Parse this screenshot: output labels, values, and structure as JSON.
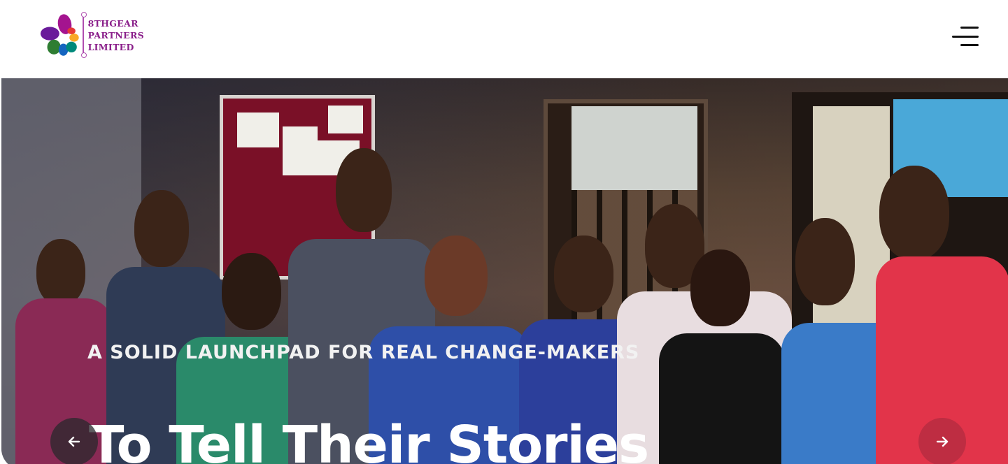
{
  "header": {
    "logo": {
      "line1": "8THGEAR",
      "line2": "PARTNERS",
      "line3": "LIMITED"
    },
    "menu_icon": "hamburger-menu-icon"
  },
  "hero": {
    "tagline": "A SOLID LAUNCHPAD FOR REAL CHANGE-MAKERS",
    "headline": "To Tell Their Stories",
    "prev_icon": "arrow-left-icon",
    "next_icon": "arrow-right-icon"
  },
  "colors": {
    "brand_purple": "#8a1f8a",
    "overlay": "#222840",
    "text_light": "#ffffff"
  }
}
